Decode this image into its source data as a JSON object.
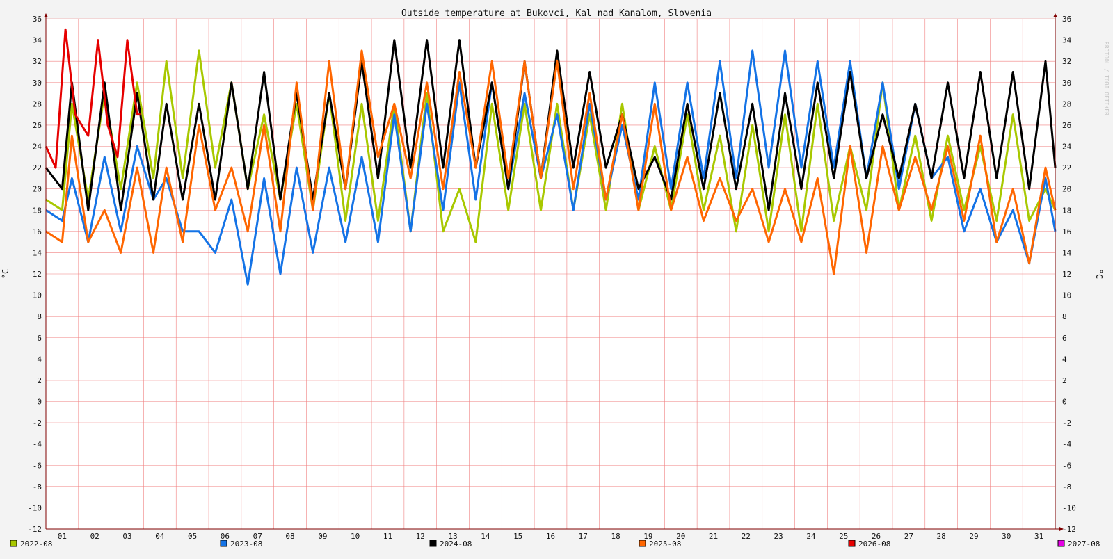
{
  "chart_data": {
    "type": "line",
    "title": "Outside temperature at Bukovci, Kal nad Kanalom, Slovenia",
    "ylabel_left": "°C",
    "ylabel_right": "°C",
    "watermark": "RRDTOOL / TOBI OETIKER",
    "ylim": [
      -12,
      36
    ],
    "y_ticks": [
      -12,
      -10,
      -8,
      -6,
      -4,
      -2,
      0,
      2,
      4,
      6,
      8,
      10,
      12,
      14,
      16,
      18,
      20,
      22,
      24,
      26,
      28,
      30,
      32,
      34,
      36
    ],
    "x_ticks": [
      "01",
      "02",
      "03",
      "04",
      "05",
      "06",
      "07",
      "08",
      "09",
      "10",
      "11",
      "12",
      "13",
      "14",
      "15",
      "16",
      "17",
      "18",
      "19",
      "20",
      "21",
      "22",
      "23",
      "24",
      "25",
      "26",
      "27",
      "28",
      "29",
      "30",
      "31"
    ],
    "xlim_days": [
      0.5,
      31.5
    ],
    "grid": true,
    "legend_position": "bottom",
    "series": [
      {
        "name": "2022-08",
        "color": "#a8c800",
        "x": [
          0.5,
          1,
          1.3,
          1.8,
          2.3,
          2.8,
          3.3,
          3.8,
          4.2,
          4.7,
          5.2,
          5.7,
          6.2,
          6.7,
          7.2,
          7.7,
          8.2,
          8.7,
          9.2,
          9.7,
          10.2,
          10.7,
          11.2,
          11.7,
          12.2,
          12.7,
          13.2,
          13.7,
          14.2,
          14.7,
          15.2,
          15.7,
          16.2,
          16.7,
          17.2,
          17.7,
          18.2,
          18.7,
          19.2,
          19.7,
          20.2,
          20.7,
          21.2,
          21.7,
          22.2,
          22.7,
          23.2,
          23.7,
          24.2,
          24.7,
          25.2,
          25.7,
          26.2,
          26.7,
          27.2,
          27.7,
          28.2,
          28.7,
          29.2,
          29.7,
          30.2,
          30.7,
          31.2,
          31.5
        ],
        "y": [
          19,
          18,
          28,
          19,
          29,
          20,
          30,
          21,
          32,
          21,
          33,
          22,
          30,
          20,
          27,
          19,
          28,
          18,
          29,
          17,
          28,
          17,
          28,
          16,
          29,
          16,
          20,
          15,
          28,
          18,
          28,
          18,
          28,
          18,
          27,
          18,
          28,
          18,
          24,
          18,
          27,
          18,
          25,
          16,
          26,
          16,
          27,
          16,
          28,
          17,
          24,
          18,
          30,
          18,
          25,
          17,
          25,
          18,
          24,
          17,
          27,
          17,
          20,
          18
        ]
      },
      {
        "name": "2023-08",
        "color": "#1473e6",
        "x": [
          0.5,
          1,
          1.3,
          1.8,
          2.3,
          2.8,
          3.3,
          3.8,
          4.2,
          4.7,
          5.2,
          5.7,
          6.2,
          6.7,
          7.2,
          7.7,
          8.2,
          8.7,
          9.2,
          9.7,
          10.2,
          10.7,
          11.2,
          11.7,
          12.2,
          12.7,
          13.2,
          13.7,
          14.2,
          14.7,
          15.2,
          15.7,
          16.2,
          16.7,
          17.2,
          17.7,
          18.2,
          18.7,
          19.2,
          19.7,
          20.2,
          20.7,
          21.2,
          21.7,
          22.2,
          22.7,
          23.2,
          23.7,
          24.2,
          24.7,
          25.2,
          25.7,
          26.2,
          26.7,
          27.2,
          27.7,
          28.2,
          28.7,
          29.2,
          29.7,
          30.2,
          30.7,
          31.2,
          31.5
        ],
        "y": [
          18,
          17,
          21,
          15,
          23,
          16,
          24,
          19,
          21,
          16,
          16,
          14,
          19,
          11,
          21,
          12,
          22,
          14,
          22,
          15,
          23,
          15,
          27,
          16,
          28,
          18,
          30,
          19,
          30,
          20,
          29,
          21,
          27,
          18,
          28,
          19,
          26,
          19,
          30,
          20,
          30,
          21,
          32,
          21,
          33,
          22,
          33,
          22,
          32,
          22,
          32,
          21,
          30,
          20,
          28,
          21,
          23,
          16,
          20,
          15,
          18,
          13,
          21,
          16
        ]
      },
      {
        "name": "2024-08",
        "color": "#000000",
        "x": [
          0.5,
          1,
          1.3,
          1.8,
          2.3,
          2.8,
          3.3,
          3.8,
          4.2,
          4.7,
          5.2,
          5.7,
          6.2,
          6.7,
          7.2,
          7.7,
          8.2,
          8.7,
          9.2,
          9.7,
          10.2,
          10.7,
          11.2,
          11.7,
          12.2,
          12.7,
          13.2,
          13.7,
          14.2,
          14.7,
          15.2,
          15.7,
          16.2,
          16.7,
          17.2,
          17.7,
          18.2,
          18.7,
          19.2,
          19.7,
          20.2,
          20.7,
          21.2,
          21.7,
          22.2,
          22.7,
          23.2,
          23.7,
          24.2,
          24.7,
          25.2,
          25.7,
          26.2,
          26.7,
          27.2,
          27.7,
          28.2,
          28.7,
          29.2,
          29.7,
          30.2,
          30.7,
          31.2,
          31.5
        ],
        "y": [
          22,
          20,
          30,
          18,
          30,
          18,
          29,
          19,
          28,
          19,
          28,
          19,
          30,
          20,
          31,
          19,
          29,
          19,
          29,
          20,
          32,
          21,
          34,
          22,
          34,
          22,
          34,
          22,
          30,
          20,
          32,
          21,
          33,
          22,
          31,
          22,
          27,
          20,
          23,
          19,
          28,
          20,
          29,
          20,
          28,
          18,
          29,
          20,
          30,
          21,
          31,
          21,
          27,
          21,
          28,
          21,
          30,
          21,
          31,
          21,
          31,
          20,
          32,
          22
        ]
      },
      {
        "name": "2025-08",
        "color": "#ff6600",
        "x": [
          0.5,
          1,
          1.3,
          1.8,
          2.3,
          2.8,
          3.3,
          3.8,
          4.2,
          4.7,
          5.2,
          5.7,
          6.2,
          6.7,
          7.2,
          7.7,
          8.2,
          8.7,
          9.2,
          9.7,
          10.2,
          10.7,
          11.2,
          11.7,
          12.2,
          12.7,
          13.2,
          13.7,
          14.2,
          14.7,
          15.2,
          15.7,
          16.2,
          16.7,
          17.2,
          17.7,
          18.2,
          18.7,
          19.2,
          19.7,
          20.2,
          20.7,
          21.2,
          21.7,
          22.2,
          22.7,
          23.2,
          23.7,
          24.2,
          24.7,
          25.2,
          25.7,
          26.2,
          26.7,
          27.2,
          27.7,
          28.2,
          28.7,
          29.2,
          29.7,
          30.2,
          30.7,
          31.2,
          31.5
        ],
        "y": [
          16,
          15,
          25,
          15,
          18,
          14,
          22,
          14,
          22,
          15,
          26,
          18,
          22,
          16,
          26,
          16,
          30,
          18,
          32,
          20,
          33,
          23,
          28,
          21,
          30,
          20,
          31,
          22,
          32,
          21,
          32,
          21,
          32,
          20,
          29,
          19,
          27,
          18,
          28,
          18,
          23,
          17,
          21,
          17,
          20,
          15,
          20,
          15,
          21,
          12,
          24,
          14,
          24,
          18,
          23,
          18,
          24,
          17,
          25,
          15,
          20,
          13,
          22,
          18
        ]
      },
      {
        "name": "2026-08",
        "color": "#e60000",
        "x": [
          0.5,
          0.8,
          1.1,
          1.4,
          1.8,
          2.1,
          2.4,
          2.7,
          3,
          3.3,
          3.4
        ],
        "y": [
          24,
          22,
          35,
          27,
          25,
          34,
          26,
          23,
          34,
          27,
          27
        ]
      },
      {
        "name": "2027-08",
        "color": "#e600e6",
        "x": [],
        "y": []
      }
    ]
  }
}
